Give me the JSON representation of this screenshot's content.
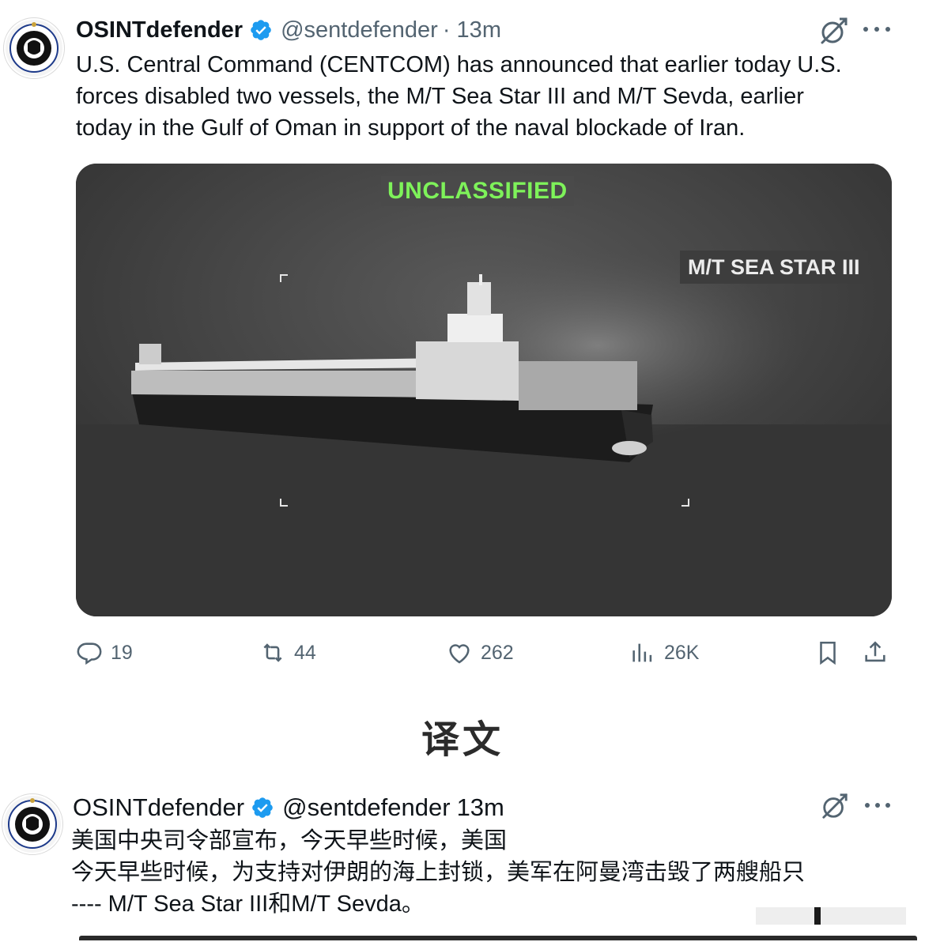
{
  "tweet": {
    "author_name": "OSINTdefender",
    "handle": "@sentdefender",
    "time": "· 13m",
    "text_lines": [
      "U.S. Central Command (CENTCOM) has announced that earlier today U.S.",
      "forces disabled two vessels, the M/T Sea Star III and M/T Sevda, earlier",
      "today in the Gulf of Oman in support of the naval blockade of Iran."
    ],
    "media": {
      "classification_label": "UNCLASSIFIED",
      "vessel_label": "M/T SEA STAR III"
    },
    "actions": {
      "replies": "19",
      "reposts": "44",
      "likes": "262",
      "views": "26K"
    }
  },
  "section_heading": "译文",
  "translated_tweet": {
    "author_name": "OSINTdefender",
    "handle": "@sentdefender",
    "time": "13m",
    "text_lines": [
      "美国中央司令部宣布，今天早些时候，美国",
      "今天早些时候，为支持对伊朗的海上封锁，美军在阿曼湾击毁了两艘船只",
      "---- M/T Sea Star III和M/T Sevda。"
    ]
  },
  "colors": {
    "verified_blue": "#1d9bf0",
    "muted_text": "#536471",
    "unclassified_green": "#7ef25a"
  },
  "icons": [
    "verified-badge-icon",
    "grok-icon",
    "more-icon",
    "reply-icon",
    "repost-icon",
    "like-icon",
    "views-icon",
    "bookmark-icon",
    "share-icon"
  ]
}
